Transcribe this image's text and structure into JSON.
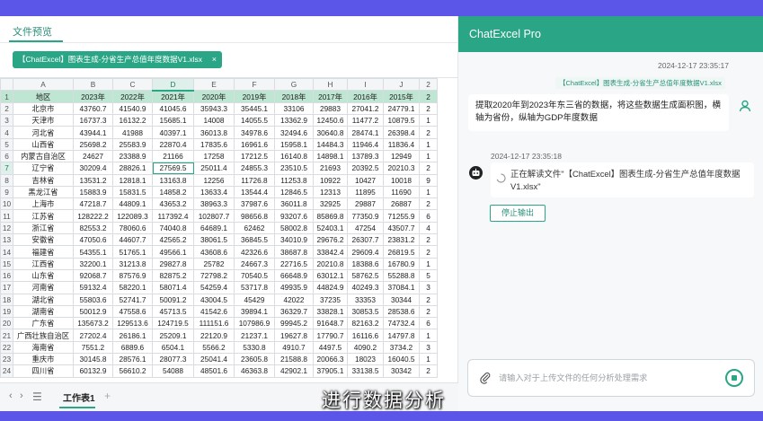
{
  "file_preview": {
    "tab_label": "文件预览",
    "file_chip": "【ChatExcel】图表生成-分省生产总值年度数据V1.xlsx",
    "close_glyph": "×"
  },
  "spreadsheet": {
    "column_letters": [
      "A",
      "B",
      "C",
      "D",
      "E",
      "F",
      "G",
      "H",
      "I",
      "J",
      "2"
    ],
    "header_row": [
      "地区",
      "2023年",
      "2022年",
      "2021年",
      "2020年",
      "2019年",
      "2018年",
      "2017年",
      "2016年",
      "2015年",
      "2"
    ],
    "rows": [
      [
        "北京市",
        "43760.7",
        "41540.9",
        "41045.6",
        "35943.3",
        "35445.1",
        "33106",
        "29883",
        "27041.2",
        "24779.1",
        "2"
      ],
      [
        "天津市",
        "16737.3",
        "16132.2",
        "15685.1",
        "14008",
        "14055.5",
        "13362.9",
        "12450.6",
        "11477.2",
        "10879.5",
        "1"
      ],
      [
        "河北省",
        "43944.1",
        "41988",
        "40397.1",
        "36013.8",
        "34978.6",
        "32494.6",
        "30640.8",
        "28474.1",
        "26398.4",
        "2"
      ],
      [
        "山西省",
        "25698.2",
        "25583.9",
        "22870.4",
        "17835.6",
        "16961.6",
        "15958.1",
        "14484.3",
        "11946.4",
        "11836.4",
        "1"
      ],
      [
        "内蒙古自治区",
        "24627",
        "23388.9",
        "21166",
        "17258",
        "17212.5",
        "16140.8",
        "14898.1",
        "13789.3",
        "12949",
        "1"
      ],
      [
        "辽宁省",
        "30209.4",
        "28826.1",
        "27569.5",
        "25011.4",
        "24855.3",
        "23510.5",
        "21693",
        "20392.5",
        "20210.3",
        "2"
      ],
      [
        "吉林省",
        "13531.2",
        "12818.1",
        "13163.8",
        "12256",
        "11726.8",
        "11253.8",
        "10922",
        "10427",
        "10018",
        "9"
      ],
      [
        "黑龙江省",
        "15883.9",
        "15831.5",
        "14858.2",
        "13633.4",
        "13544.4",
        "12846.5",
        "12313",
        "11895",
        "11690",
        "1"
      ],
      [
        "上海市",
        "47218.7",
        "44809.1",
        "43653.2",
        "38963.3",
        "37987.6",
        "36011.8",
        "32925",
        "29887",
        "26887",
        "2"
      ],
      [
        "江苏省",
        "128222.2",
        "122089.3",
        "117392.4",
        "102807.7",
        "98656.8",
        "93207.6",
        "85869.8",
        "77350.9",
        "71255.9",
        "6"
      ],
      [
        "浙江省",
        "82553.2",
        "78060.6",
        "74040.8",
        "64689.1",
        "62462",
        "58002.8",
        "52403.1",
        "47254",
        "43507.7",
        "4"
      ],
      [
        "安徽省",
        "47050.6",
        "44607.7",
        "42565.2",
        "38061.5",
        "36845.5",
        "34010.9",
        "29676.2",
        "26307.7",
        "23831.2",
        "2"
      ],
      [
        "福建省",
        "54355.1",
        "51765.1",
        "49566.1",
        "43608.6",
        "42326.6",
        "38687.8",
        "33842.4",
        "29609.4",
        "26819.5",
        "2"
      ],
      [
        "江西省",
        "32200.1",
        "31213.8",
        "29827.8",
        "25782",
        "24667.3",
        "22716.5",
        "20210.8",
        "18388.6",
        "16780.9",
        "1"
      ],
      [
        "山东省",
        "92068.7",
        "87576.9",
        "82875.2",
        "72798.2",
        "70540.5",
        "66648.9",
        "63012.1",
        "58762.5",
        "55288.8",
        "5"
      ],
      [
        "河南省",
        "59132.4",
        "58220.1",
        "58071.4",
        "54259.4",
        "53717.8",
        "49935.9",
        "44824.9",
        "40249.3",
        "37084.1",
        "3"
      ],
      [
        "湖北省",
        "55803.6",
        "52741.7",
        "50091.2",
        "43004.5",
        "45429",
        "42022",
        "37235",
        "33353",
        "30344",
        "2"
      ],
      [
        "湖南省",
        "50012.9",
        "47558.6",
        "45713.5",
        "41542.6",
        "39894.1",
        "36329.7",
        "33828.1",
        "30853.5",
        "28538.6",
        "2"
      ],
      [
        "广东省",
        "135673.2",
        "129513.6",
        "124719.5",
        "111151.6",
        "107986.9",
        "99945.2",
        "91648.7",
        "82163.2",
        "74732.4",
        "6"
      ],
      [
        "广西壮族自治区",
        "27202.4",
        "26186.1",
        "25209.1",
        "22120.9",
        "21237.1",
        "19627.8",
        "17790.7",
        "16116.6",
        "14797.8",
        "1"
      ],
      [
        "海南省",
        "7551.2",
        "6889.6",
        "6504.1",
        "5566.2",
        "5330.8",
        "4910.7",
        "4497.5",
        "4090.2",
        "3734.2",
        "3"
      ],
      [
        "重庆市",
        "30145.8",
        "28576.1",
        "28077.3",
        "25041.4",
        "23605.8",
        "21588.8",
        "20066.3",
        "18023",
        "16040.5",
        "1"
      ],
      [
        "四川省",
        "60132.9",
        "56610.2",
        "54088",
        "48501.6",
        "46363.8",
        "42902.1",
        "37905.1",
        "33138.5",
        "30342",
        "2"
      ]
    ],
    "sheet_tab": "工作表1",
    "nav_prev": "‹",
    "nav_next": "›",
    "sheet_menu": "☰",
    "add_sheet": "+"
  },
  "chat": {
    "title": "ChatExcel Pro",
    "timestamp_user": "2024-12-17 23:35:17",
    "referenced_file": "【ChatExcel】图表生成-分省生产总值年度数据V1.xlsx",
    "user_message": "提取2020年到2023年东三省的数据，将这些数据生成面积图，横轴为省份，纵轴为GDP年度数据",
    "timestamp_bot": "2024-12-17 23:35:18",
    "bot_message": "正在解读文件\"【ChatExcel】图表生成-分省生产总值年度数据V1.xlsx\"",
    "stop_button": "停止输出",
    "input_placeholder": "请输入对于上传文件的任何分析处理需求"
  },
  "caption": "进行数据分析",
  "colors": {
    "brand_green": "#2aa686",
    "frame_purple": "#5b55e8",
    "header_row_fill": "#bfe5d3"
  }
}
